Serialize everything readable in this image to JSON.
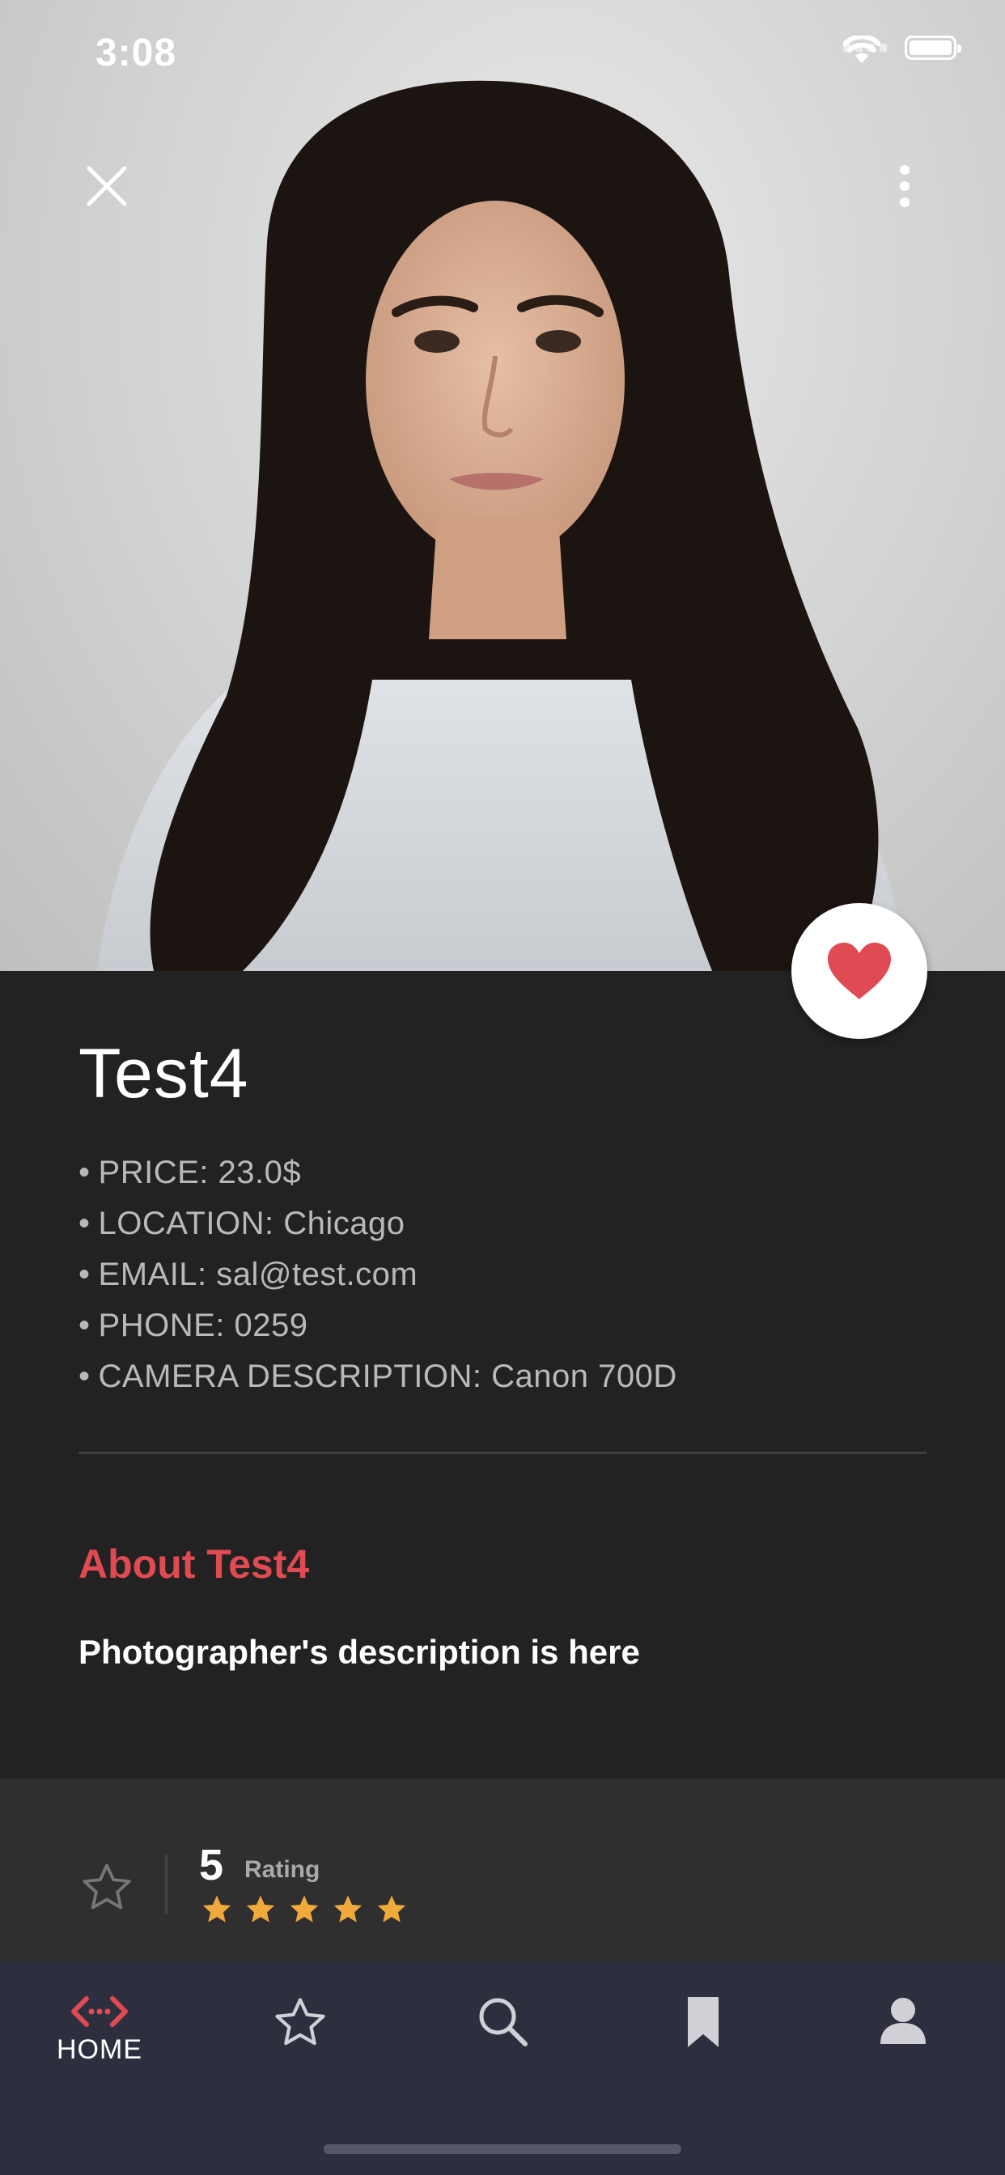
{
  "status_bar": {
    "time": "3:08"
  },
  "hero": {
    "image": "profile-photo-of-woman-with-long-dark-hair"
  },
  "profile": {
    "name": "Test4",
    "details": [
      "PRICE:  23.0$",
      "LOCATION:  Chicago",
      "EMAIL: sal@test.com",
      "PHONE: 0259",
      "CAMERA DESCRIPTION:  Canon 700D"
    ],
    "about_title": "About Test4",
    "about_text": "Photographer's description is here"
  },
  "rating": {
    "value": "5",
    "label": "Rating",
    "stars_filled": 5,
    "stars_total": 5
  },
  "nav": {
    "items": [
      {
        "icon": "code-icon",
        "label": "HOME",
        "active": true
      },
      {
        "icon": "star-icon",
        "label": ""
      },
      {
        "icon": "search-icon",
        "label": ""
      },
      {
        "icon": "bookmark-icon",
        "label": ""
      },
      {
        "icon": "person-icon",
        "label": ""
      }
    ]
  },
  "colors": {
    "accent": "#e04a52",
    "star": "#f0a93b",
    "nav_bg": "#2d2f3f",
    "body_bg": "#222222"
  }
}
